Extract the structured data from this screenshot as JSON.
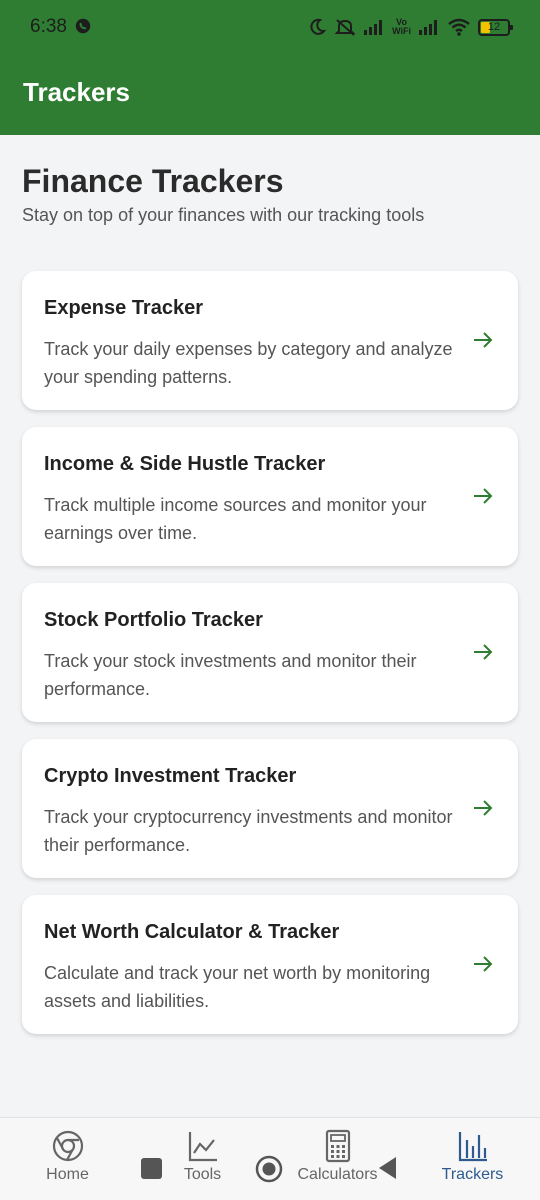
{
  "status_bar": {
    "time": "6:38",
    "vowifi_top": "Vo",
    "vowifi_bottom": "WiFi",
    "battery": "12"
  },
  "app_bar": {
    "title": "Trackers",
    "color": "#2e7d32"
  },
  "header": {
    "title": "Finance Trackers",
    "subtitle": "Stay on top of your finances with our tracking tools"
  },
  "trackers": [
    {
      "title": "Expense Tracker",
      "description": "Track your daily expenses by category and analyze your spending patterns."
    },
    {
      "title": "Income & Side Hustle Tracker",
      "description": "Track multiple income sources and monitor your earnings over time."
    },
    {
      "title": "Stock Portfolio Tracker",
      "description": "Track your stock investments and monitor their performance."
    },
    {
      "title": "Crypto Investment Tracker",
      "description": "Track your cryptocurrency investments and monitor their performance."
    },
    {
      "title": "Net Worth Calculator & Tracker",
      "description": "Calculate and track your net worth by monitoring assets and liabilities."
    }
  ],
  "bottom_nav": {
    "items": [
      {
        "label": "Home",
        "icon": "home-icon"
      },
      {
        "label": "Tools",
        "icon": "chart-line-icon"
      },
      {
        "label": "Calculators",
        "icon": "calculator-icon"
      },
      {
        "label": "Trackers",
        "icon": "bar-chart-icon",
        "active": true
      }
    ],
    "active_color": "#2e5a8f"
  }
}
